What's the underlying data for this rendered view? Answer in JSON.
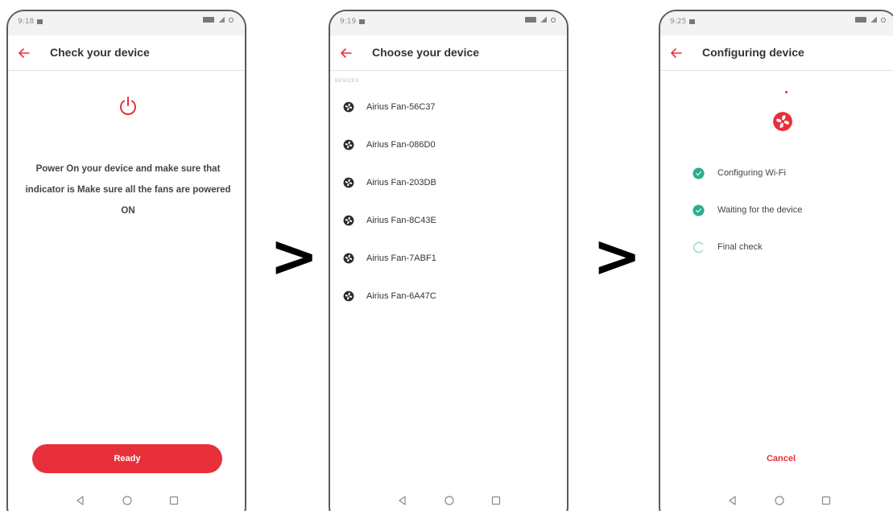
{
  "colors": {
    "accent": "#e8303a",
    "step_done": "#2cae8e",
    "step_pending": "#8fd3c8"
  },
  "screens": [
    {
      "status_time": "9:18",
      "title": "Check your device",
      "icon": "power-icon",
      "instruction": "Power On your device and make sure that indicator is Make sure all the fans are powered ON",
      "button_label": "Ready"
    },
    {
      "status_time": "9:19",
      "title": "Choose your device",
      "section_label": "DEVICES",
      "devices": [
        "Airius Fan-56C37",
        "Airius Fan-086D0",
        "Airius Fan-203DB",
        "Airius Fan-8C43E",
        "Airius Fan-7ABF1",
        "Airius Fan-6A47C"
      ]
    },
    {
      "status_time": "9:25",
      "title": "Configuring device",
      "steps": [
        {
          "label": "Configuring Wi-Fi",
          "state": "done"
        },
        {
          "label": "Waiting for the device",
          "state": "done"
        },
        {
          "label": "Final check",
          "state": "in-progress"
        }
      ],
      "cancel_label": "Cancel"
    }
  ],
  "separators": [
    ">",
    ">"
  ]
}
